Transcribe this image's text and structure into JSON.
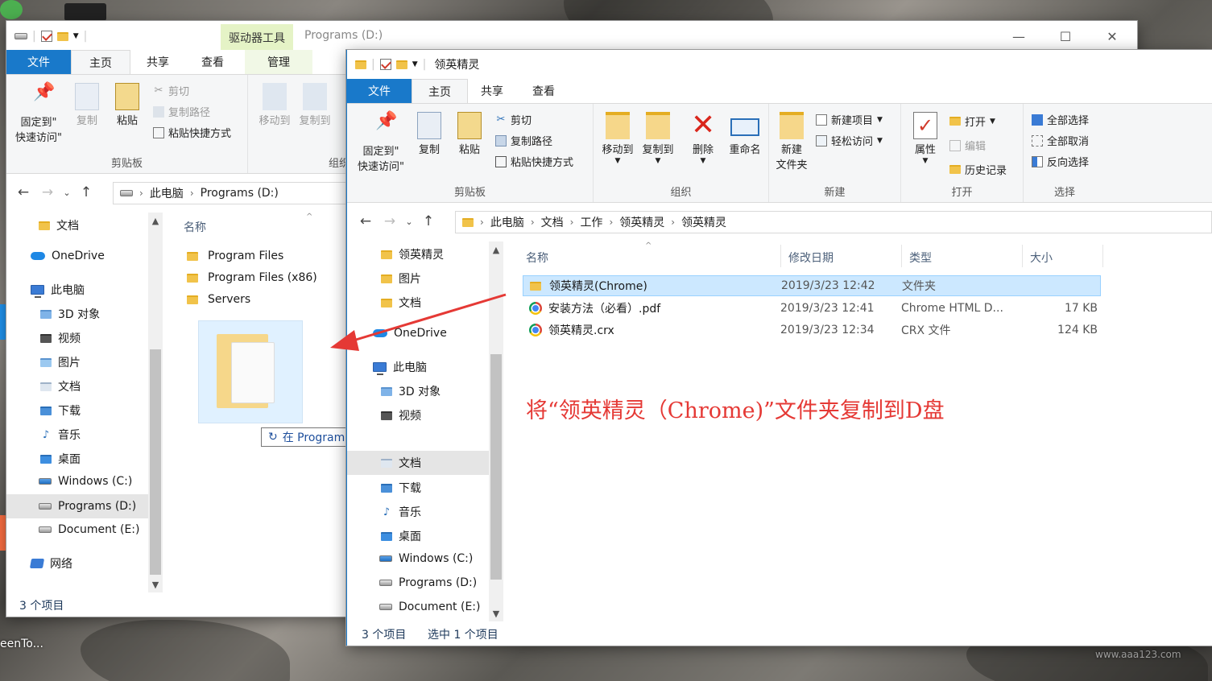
{
  "background_window": {
    "context_tab": "驱动器工具",
    "title": "Programs (D:)",
    "tabs": [
      "文件",
      "主页",
      "共享",
      "查看",
      "管理"
    ],
    "ribbon": {
      "pin_label": "固定到\"\n快速访问\"",
      "copy_label": "复制",
      "paste_label": "粘贴",
      "cut_label": "剪切",
      "copy_path_label": "复制路径",
      "paste_shortcut_label": "粘贴快捷方式",
      "group_clipboard": "剪贴板",
      "move_to_label": "移动到",
      "copy_to_label": "复制到",
      "group_organize": "组织"
    },
    "address": [
      "此电脑",
      "Programs (D:)"
    ],
    "nav_items": [
      "文档",
      "OneDrive",
      "此电脑",
      "3D 对象",
      "视频",
      "图片",
      "文档",
      "下载",
      "音乐",
      "桌面",
      "Windows (C:)",
      "Programs (D:)",
      "Document (E:)",
      "网络"
    ],
    "column_name": "名称",
    "files": [
      "Program Files",
      "Program Files (x86)",
      "Servers"
    ],
    "status": "3 个项目",
    "drag_tooltip": "在 Programs (D:) 创建链接"
  },
  "foreground_window": {
    "title": "领英精灵",
    "tabs": [
      "文件",
      "主页",
      "共享",
      "查看"
    ],
    "ribbon": {
      "pin_label": "固定到\"\n快速访问\"",
      "copy_label": "复制",
      "paste_label": "粘贴",
      "cut_label": "剪切",
      "copy_path_label": "复制路径",
      "paste_shortcut_label": "粘贴快捷方式",
      "group_clipboard": "剪贴板",
      "move_to_label": "移动到",
      "copy_to_label": "复制到",
      "delete_label": "删除",
      "rename_label": "重命名",
      "group_organize": "组织",
      "new_folder_label": "新建\n文件夹",
      "new_item_label": "新建项目",
      "easy_access_label": "轻松访问",
      "group_new": "新建",
      "properties_label": "属性",
      "open_label": "打开",
      "edit_label": "编辑",
      "history_label": "历史记录",
      "group_open": "打开",
      "select_all_label": "全部选择",
      "select_none_label": "全部取消",
      "invert_label": "反向选择",
      "group_select": "选择"
    },
    "address": [
      "此电脑",
      "文档",
      "工作",
      "领英精灵",
      "领英精灵"
    ],
    "nav_items": [
      "领英精灵",
      "图片",
      "文档",
      "OneDrive",
      "此电脑",
      "3D 对象",
      "视频",
      "文档",
      "下载",
      "音乐",
      "桌面",
      "Windows (C:)",
      "Programs (D:)",
      "Document (E:)"
    ],
    "columns": {
      "name": "名称",
      "date": "修改日期",
      "type": "类型",
      "size": "大小"
    },
    "files": [
      {
        "name": "领英精灵(Chrome)",
        "date": "2019/3/23 12:42",
        "type": "文件夹",
        "size": "",
        "icon": "folder-icon"
      },
      {
        "name": "安装方法（必看）.pdf",
        "date": "2019/3/23 12:41",
        "type": "Chrome HTML D...",
        "size": "17 KB",
        "icon": "chrome-icon"
      },
      {
        "name": "领英精灵.crx",
        "date": "2019/3/23 12:34",
        "type": "CRX 文件",
        "size": "124 KB",
        "icon": "chrome-icon"
      }
    ],
    "status_items": "3 个项目",
    "status_selected": "选中 1 个项目"
  },
  "annotation": "将“领英精灵（Chrome)”文件夹复制到D盘",
  "desktop_text": "eenTo...",
  "watermark": "www.aaa123.com",
  "colors": {
    "accent": "#1979ca",
    "annotation": "#e53935",
    "selection": "#cce8ff"
  }
}
